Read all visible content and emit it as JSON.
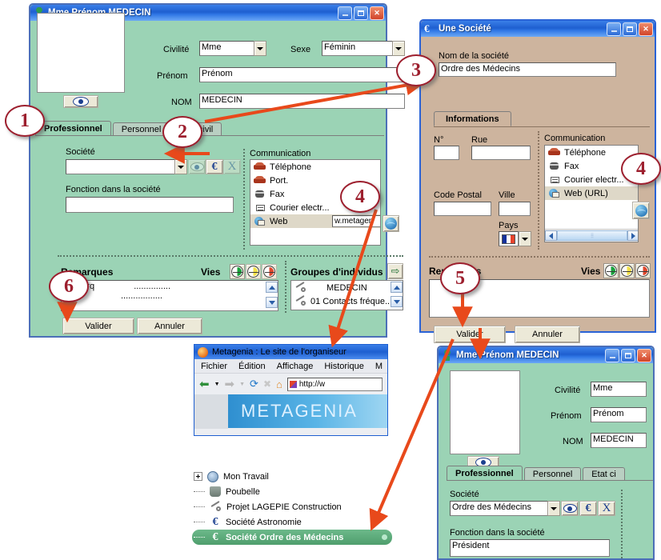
{
  "individual_window": {
    "title": "Mme Prénom MEDECIN",
    "fields": {
      "civilite_label": "Civilité",
      "civilite_value": "Mme",
      "sexe_label": "Sexe",
      "sexe_value": "Féminin",
      "prenom_label": "Prénom",
      "prenom_value": "Prénom",
      "nom_label": "NOM",
      "nom_value": "MEDECIN"
    },
    "tabs": [
      {
        "label": "Professionnel",
        "active": true
      },
      {
        "label": "Personnel",
        "active": false
      },
      {
        "label": "Etat civil",
        "active": false
      }
    ],
    "societe_label": "Société",
    "societe_value": "",
    "fonction_label": "Fonction dans la société",
    "fonction_value": "",
    "communication_label": "Communication",
    "communication_items": [
      {
        "label": "Téléphone",
        "icon": "phone-icon",
        "value": ""
      },
      {
        "label": "Port.",
        "icon": "phone-icon",
        "value": ""
      },
      {
        "label": "Fax",
        "icon": "fax-icon",
        "value": ""
      },
      {
        "label": "Courier electr...",
        "icon": "mail-icon",
        "value": ""
      },
      {
        "label": "Web",
        "icon": "web-icon",
        "value": "w.metagen"
      }
    ],
    "remarques_label": "Remarques",
    "remarques_value": "Remarq",
    "remarques_dots": "...............",
    "remarques_dots2": ".................",
    "vies_label": "Vies",
    "groupes_label": "Groupes d'individus",
    "groupes_items": [
      "MEDECIN",
      "01 Contacts  fréque..."
    ],
    "valider_label": "Valider",
    "annuler_label": "Annuler",
    "buttons": {
      "euro": "€",
      "x": "X"
    }
  },
  "societe_window": {
    "title": "Une Société",
    "title_icon": "€",
    "nom_label": "Nom de la société",
    "nom_value": "Ordre des Médecins",
    "tabs": [
      {
        "label": "Informations",
        "active": true
      }
    ],
    "num_label": "N°",
    "num_value": "",
    "rue_label": "Rue",
    "rue_value": "",
    "code_postal_label": "Code Postal",
    "code_postal_value": "",
    "ville_label": "Ville",
    "ville_value": "",
    "pays_label": "Pays",
    "pays_value": "france-flag",
    "communication_label": "Communication",
    "communication_items": [
      {
        "label": "Téléphone",
        "icon": "phone-icon"
      },
      {
        "label": "Fax",
        "icon": "fax-icon"
      },
      {
        "label": "Courier electr...",
        "icon": "mail-icon"
      },
      {
        "label": "Web (URL)",
        "icon": "web-icon"
      }
    ],
    "remarques_label": "Remarques",
    "remarques_value": "",
    "vies_label": "Vies",
    "valider_label": "Valider",
    "annuler_label": "Annuler"
  },
  "browser_window": {
    "title": "Metagenia : Le site de l'organiseur",
    "menu": [
      "Fichier",
      "Édition",
      "Affichage",
      "Historique",
      "M"
    ],
    "address_value": "http://w",
    "banner_text": "METAGENIA"
  },
  "tree": {
    "items": [
      {
        "label": "Mon Travail",
        "icon": "gear-icon",
        "expandable": true,
        "selected": false
      },
      {
        "label": "Poubelle",
        "icon": "trash-icon",
        "expandable": false,
        "selected": false
      },
      {
        "label": "Projet LAGEPIE Construction",
        "icon": "pin-icon",
        "expandable": false,
        "selected": false
      },
      {
        "label": "Société Astronomie",
        "icon": "euro-icon",
        "expandable": false,
        "selected": false
      },
      {
        "label": "Société Ordre des Médecins",
        "icon": "euro-icon",
        "expandable": false,
        "selected": true
      }
    ]
  },
  "individual_window_2": {
    "title": "Mme Prénom MEDECIN",
    "fields": {
      "civilite_label": "Civilité",
      "civilite_value": "Mme",
      "prenom_label": "Prénom",
      "prenom_value": "Prénom",
      "nom_label": "NOM",
      "nom_value": "MEDECIN"
    },
    "tabs": [
      {
        "label": "Professionnel",
        "active": true
      },
      {
        "label": "Personnel",
        "active": false
      },
      {
        "label": "Etat ci",
        "active": false
      }
    ],
    "societe_label": "Société",
    "societe_value": "Ordre des Médecins",
    "fonction_label": "Fonction dans la société",
    "fonction_value": "Président",
    "buttons": {
      "euro": "€",
      "x": "X"
    }
  },
  "callouts": [
    {
      "n": "1"
    },
    {
      "n": "2"
    },
    {
      "n": "3"
    },
    {
      "n": "4"
    },
    {
      "n": "4b"
    },
    {
      "n": "5"
    },
    {
      "n": "6"
    }
  ],
  "callout_numbers": {
    "one": "1",
    "two": "2",
    "three": "3",
    "four_a": "4",
    "four_b": "4",
    "five": "5",
    "six": "6"
  },
  "colors": {
    "title_blue": "#1e5fd0",
    "green_body": "#9bd3b5",
    "tan_body": "#cdb49e",
    "callout_red": "#9d1f2e",
    "arrow_orange": "#e8491b"
  }
}
